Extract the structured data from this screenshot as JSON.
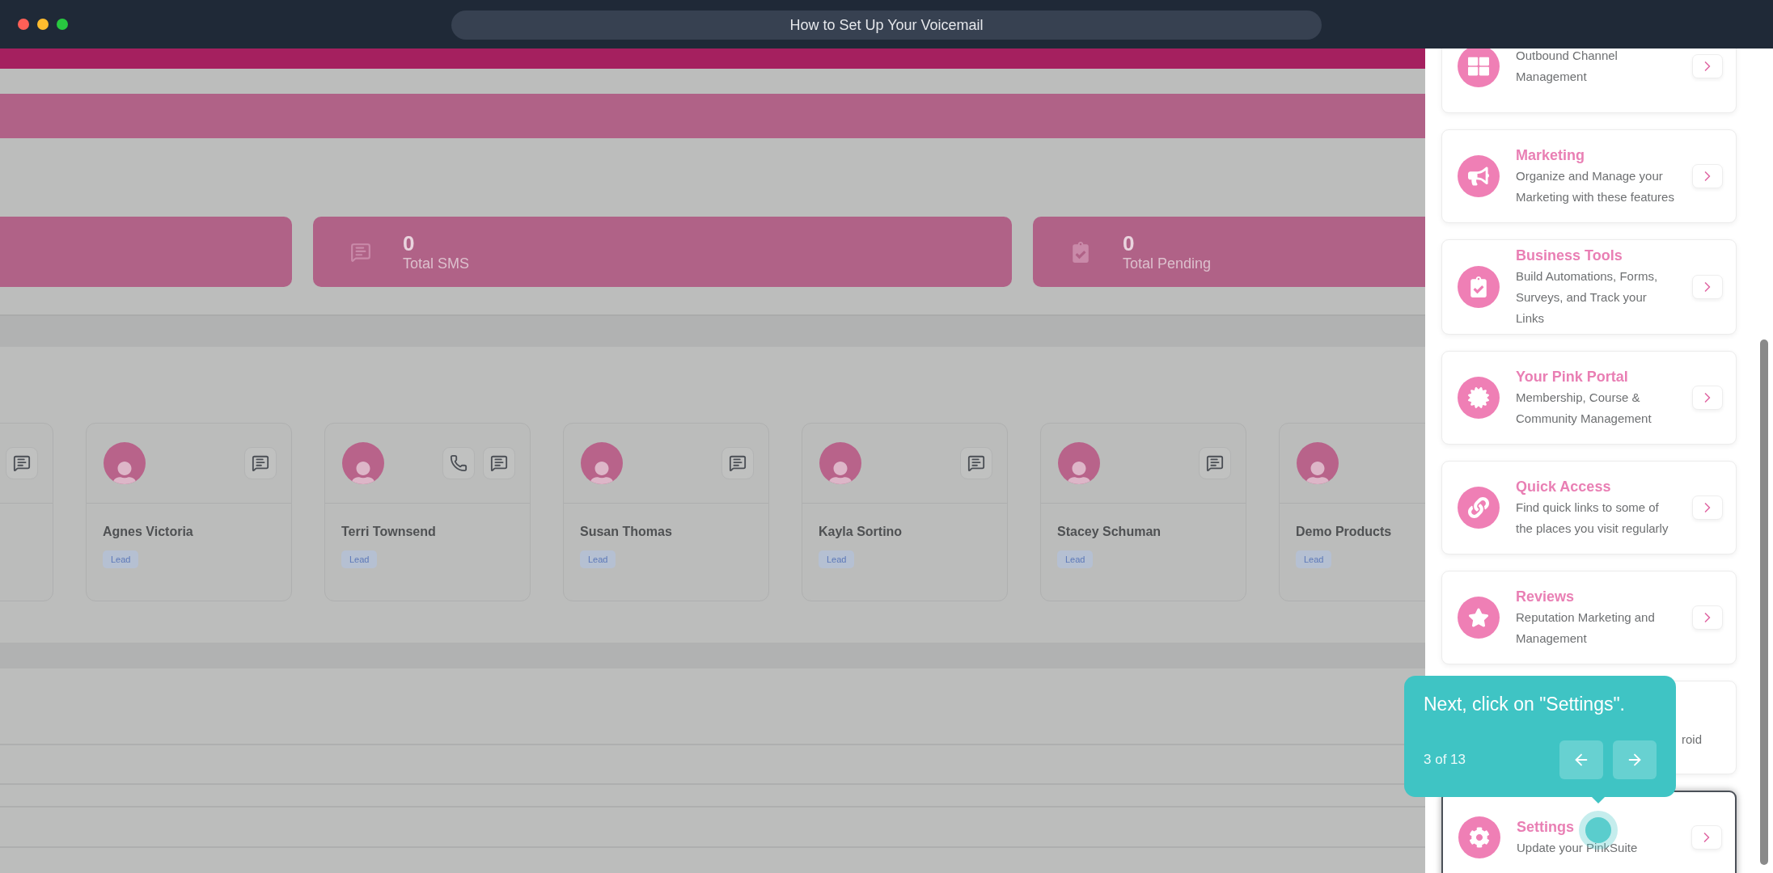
{
  "window": {
    "title": "How to Set Up Your Voicemail"
  },
  "stats": [
    {
      "value": "0",
      "label": "Total SMS"
    },
    {
      "value": "0",
      "label": "Total Pending"
    }
  ],
  "contacts": [
    {
      "name": "Agnes Victoria",
      "tag": "Lead",
      "has_call": false
    },
    {
      "name": "Terri Townsend",
      "tag": "Lead",
      "has_call": true
    },
    {
      "name": "Susan Thomas",
      "tag": "Lead",
      "has_call": false
    },
    {
      "name": "Kayla Sortino",
      "tag": "Lead",
      "has_call": false
    },
    {
      "name": "Stacey Schuman",
      "tag": "Lead",
      "has_call": false
    },
    {
      "name": "Demo Products",
      "tag": "Lead",
      "has_call": false
    }
  ],
  "menu_cards": [
    {
      "kind": "full",
      "description": "Outbound Channel Management",
      "highlighted": false
    },
    {
      "kind": "full",
      "title": "Marketing",
      "description": "Organize and Manage your Marketing with these features",
      "highlighted": false
    },
    {
      "kind": "full",
      "title": "Business Tools",
      "description": "Build Automations, Forms, Surveys, and Track your Links",
      "highlighted": false
    },
    {
      "kind": "full",
      "title": "Your Pink Portal",
      "description": "Membership, Course & Community Management",
      "highlighted": false
    },
    {
      "kind": "full",
      "title": "Quick Access",
      "description": "Find quick links to some of the places you visit regularly",
      "highlighted": false
    },
    {
      "kind": "full",
      "title": "Reviews",
      "description": "Reputation Marketing and Management",
      "highlighted": false
    },
    {
      "kind": "covered",
      "description": "roid",
      "highlighted": false
    },
    {
      "kind": "full",
      "title": "Settings",
      "description": "Update your PinkSuite",
      "highlighted": true
    }
  ],
  "tooltip": {
    "text": "Next, click on \"Settings\".",
    "step": "3 of 13"
  }
}
